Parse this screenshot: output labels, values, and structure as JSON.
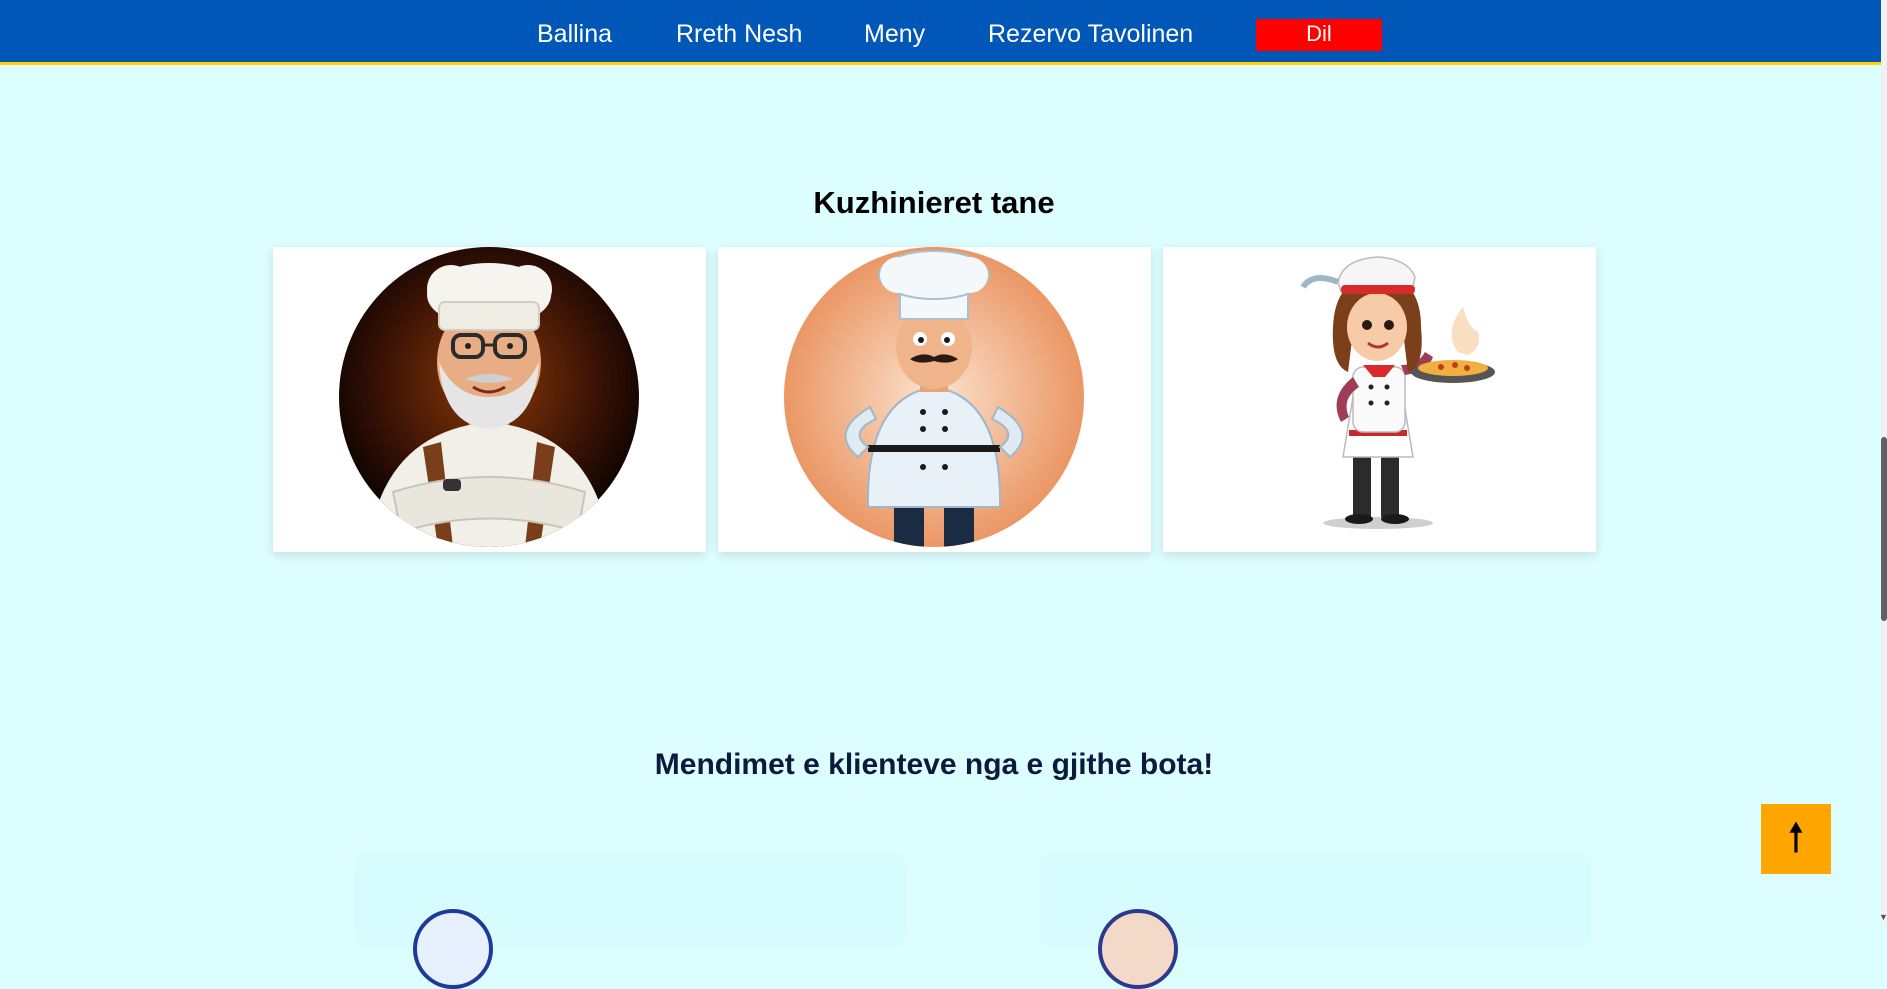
{
  "nav": {
    "items": [
      {
        "label": "Ballina"
      },
      {
        "label": "Rreth Nesh"
      },
      {
        "label": "Meny"
      },
      {
        "label": "Rezervo Tavolinen"
      }
    ],
    "logout_label": "Dil"
  },
  "chefs": {
    "title": "Kuzhinieret tane",
    "cards": [
      {
        "image": "chef-elder-portrait"
      },
      {
        "image": "chef-mustache-portrait"
      },
      {
        "image": "chef-woman-pizza-portrait"
      }
    ]
  },
  "reviews": {
    "title": "Mendimet e klienteve nga e gjithe bota!"
  },
  "scroll_top": {
    "icon": "arrow-up-icon",
    "symbol": "🠕"
  },
  "colors": {
    "background": "#dcfeff",
    "navbar": "#0057b7",
    "navbar_border": "#ffd400",
    "logout": "#ff0000",
    "scroll_top": "#ffa500"
  }
}
